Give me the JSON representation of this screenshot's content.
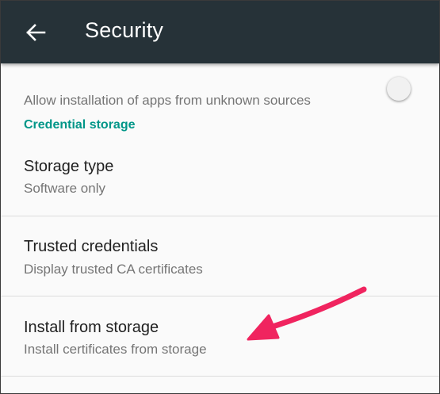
{
  "appbar": {
    "title": "Security",
    "back_icon": "arrow-left-icon"
  },
  "partial_item": {
    "subtitle": "Allow installation of apps from unknown sources"
  },
  "section": {
    "header": "Credential storage"
  },
  "items": [
    {
      "title": "Storage type",
      "subtitle": "Software only"
    },
    {
      "title": "Trusted credentials",
      "subtitle": "Display trusted CA certificates"
    },
    {
      "title": "Install from storage",
      "subtitle": "Install certificates from storage"
    }
  ],
  "colors": {
    "appbar": "#263238",
    "accent": "#009688",
    "annotation_arrow": "#f0245f"
  }
}
